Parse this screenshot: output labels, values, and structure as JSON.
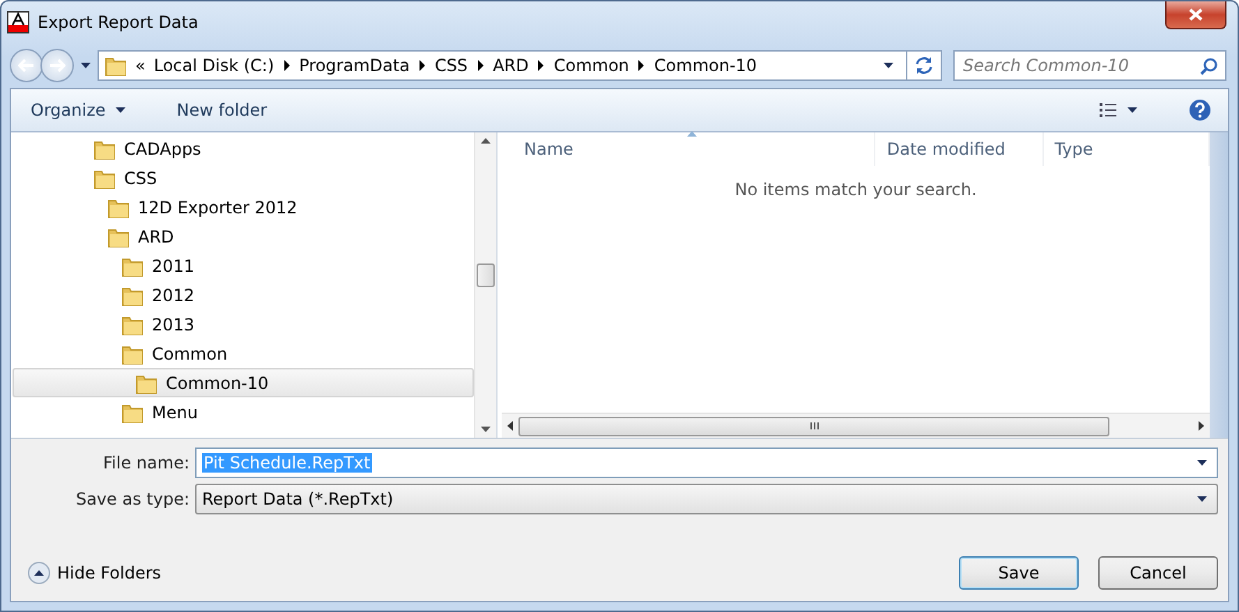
{
  "window": {
    "title": "Export Report Data"
  },
  "address": {
    "overflow_marker": "«",
    "breadcrumbs": [
      "Local Disk (C:)",
      "ProgramData",
      "CSS",
      "ARD",
      "Common",
      "Common-10"
    ]
  },
  "search": {
    "placeholder": "Search Common-10"
  },
  "toolbar": {
    "organize": "Organize",
    "new_folder": "New folder"
  },
  "tree": {
    "items": [
      {
        "label": "CADApps",
        "selected": false
      },
      {
        "label": "CSS",
        "selected": false,
        "children": [
          {
            "label": "12D Exporter 2012",
            "selected": false
          },
          {
            "label": "ARD",
            "selected": false,
            "children": [
              {
                "label": "2011",
                "selected": false
              },
              {
                "label": "2012",
                "selected": false
              },
              {
                "label": "2013",
                "selected": false
              },
              {
                "label": "Common",
                "selected": false,
                "children": [
                  {
                    "label": "Common-10",
                    "selected": true
                  }
                ]
              },
              {
                "label": "Menu",
                "selected": false
              }
            ]
          }
        ]
      }
    ]
  },
  "file_list": {
    "columns": [
      "Name",
      "Date modified",
      "Type"
    ],
    "empty_message": "No items match your search."
  },
  "file_name": {
    "label": "File name:",
    "value": "Pit Schedule.RepTxt"
  },
  "save_as_type": {
    "label": "Save as type:",
    "value": "Report Data (*.RepTxt)"
  },
  "hide_folders": "Hide Folders",
  "buttons": [
    {
      "label": "Save",
      "default": true
    },
    {
      "label": "Cancel",
      "default": false
    }
  ]
}
